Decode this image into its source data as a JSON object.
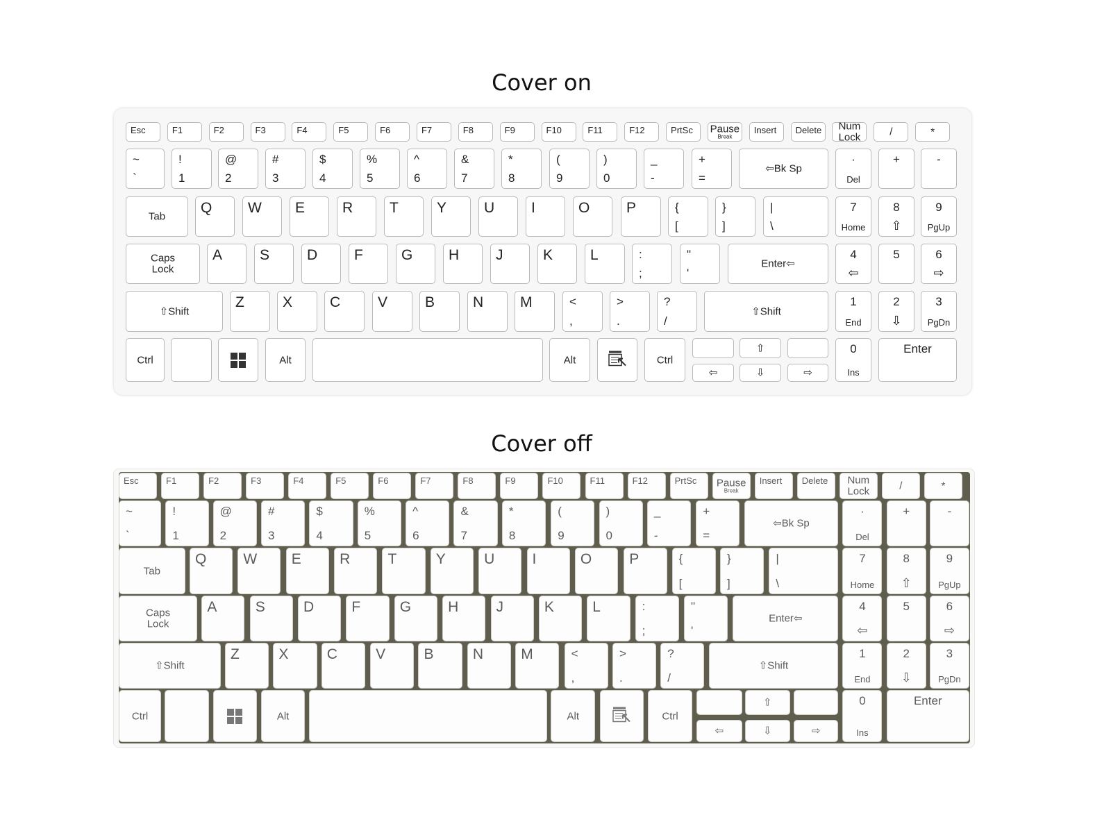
{
  "titles": {
    "cover_on": "Cover on",
    "cover_off": "Cover off"
  },
  "colors": {
    "key_outline": "#b9b9b9",
    "base_gap": "#5f5d4e",
    "label": "#222222"
  },
  "rows": [
    [
      {
        "fn": "Esc"
      },
      {
        "fn": "F1"
      },
      {
        "fn": "F2"
      },
      {
        "fn": "F3"
      },
      {
        "fn": "F4"
      },
      {
        "fn": "F5"
      },
      {
        "fn": "F6"
      },
      {
        "fn": "F7"
      },
      {
        "fn": "F8"
      },
      {
        "fn": "F9"
      },
      {
        "fn": "F10"
      },
      {
        "fn": "F11"
      },
      {
        "fn": "F12"
      },
      {
        "fn": "PrtSc"
      },
      {
        "c": "Pause",
        "sub": "Break"
      },
      {
        "fn": "Insert"
      },
      {
        "fn": "Delete"
      },
      {
        "c": "Num\nLock"
      },
      {
        "c": "/"
      },
      {
        "c": "*"
      }
    ],
    [
      {
        "t": "~",
        "b": "`"
      },
      {
        "t": "!",
        "b": "1"
      },
      {
        "t": "@",
        "b": "2"
      },
      {
        "t": "#",
        "b": "3"
      },
      {
        "t": "$",
        "b": "4"
      },
      {
        "t": "%",
        "b": "5"
      },
      {
        "t": "^",
        "b": "6"
      },
      {
        "t": "&",
        "b": "7"
      },
      {
        "t": "*",
        "b": "8"
      },
      {
        "t": "(",
        "b": "9"
      },
      {
        "t": ")",
        "b": "0"
      },
      {
        "t": "_",
        "b": "-"
      },
      {
        "t": "+",
        "b": "="
      },
      {
        "c": "⇦Bk Sp"
      },
      {
        "nt": "·",
        "nb": "Del"
      },
      {
        "nt": "+"
      },
      {
        "nt": "-"
      }
    ],
    [
      {
        "c": "Tab"
      },
      {
        "tl": "Q"
      },
      {
        "tl": "W"
      },
      {
        "tl": "E"
      },
      {
        "tl": "R"
      },
      {
        "tl": "T"
      },
      {
        "tl": "Y"
      },
      {
        "tl": "U"
      },
      {
        "tl": "I"
      },
      {
        "tl": "O"
      },
      {
        "tl": "P"
      },
      {
        "t": "{",
        "b": "["
      },
      {
        "t": "}",
        "b": "]"
      },
      {
        "t": "|",
        "b": "\\"
      },
      {
        "nt": "7",
        "nb": "Home"
      },
      {
        "nt": "8",
        "nb": "⇧"
      },
      {
        "nt": "9",
        "nb": "PgUp"
      }
    ],
    [
      {
        "c": "Caps\nLock"
      },
      {
        "tl": "A"
      },
      {
        "tl": "S"
      },
      {
        "tl": "D"
      },
      {
        "tl": "F"
      },
      {
        "tl": "G"
      },
      {
        "tl": "H"
      },
      {
        "tl": "J"
      },
      {
        "tl": "K"
      },
      {
        "tl": "L"
      },
      {
        "t": ":",
        "b": ";"
      },
      {
        "t": "\"",
        "b": "'"
      },
      {
        "c": "Enter⇦"
      },
      {
        "nt": "4",
        "nb": "⇦"
      },
      {
        "nt": "5"
      },
      {
        "nt": "6",
        "nb": "⇨"
      }
    ],
    [
      {
        "c": "⇧Shift"
      },
      {
        "tl": "Z"
      },
      {
        "tl": "X"
      },
      {
        "tl": "C"
      },
      {
        "tl": "V"
      },
      {
        "tl": "B"
      },
      {
        "tl": "N"
      },
      {
        "tl": "M"
      },
      {
        "t": "<",
        "b": ","
      },
      {
        "t": ">",
        "b": "."
      },
      {
        "t": "?",
        "b": "/"
      },
      {
        "c": "⇧Shift"
      },
      {
        "nt": "1",
        "nb": "End"
      },
      {
        "nt": "2",
        "nb": "⇩"
      },
      {
        "nt": "3",
        "nb": "PgDn"
      }
    ],
    [
      {
        "c": "Ctrl"
      },
      {
        "c": ""
      },
      {
        "icon": "windows-icon"
      },
      {
        "c": "Alt"
      },
      {
        "c": ""
      },
      {
        "c": "Alt"
      },
      {
        "icon": "menu-icon"
      },
      {
        "c": "Ctrl"
      },
      {
        "c": ""
      },
      {
        "c": "⇧"
      },
      {
        "c": ""
      },
      {
        "c": "⇦"
      },
      {
        "c": "⇩"
      },
      {
        "c": "⇨"
      },
      {
        "nt": "0",
        "nb": "Ins"
      },
      {
        "nt": "Enter"
      }
    ]
  ]
}
